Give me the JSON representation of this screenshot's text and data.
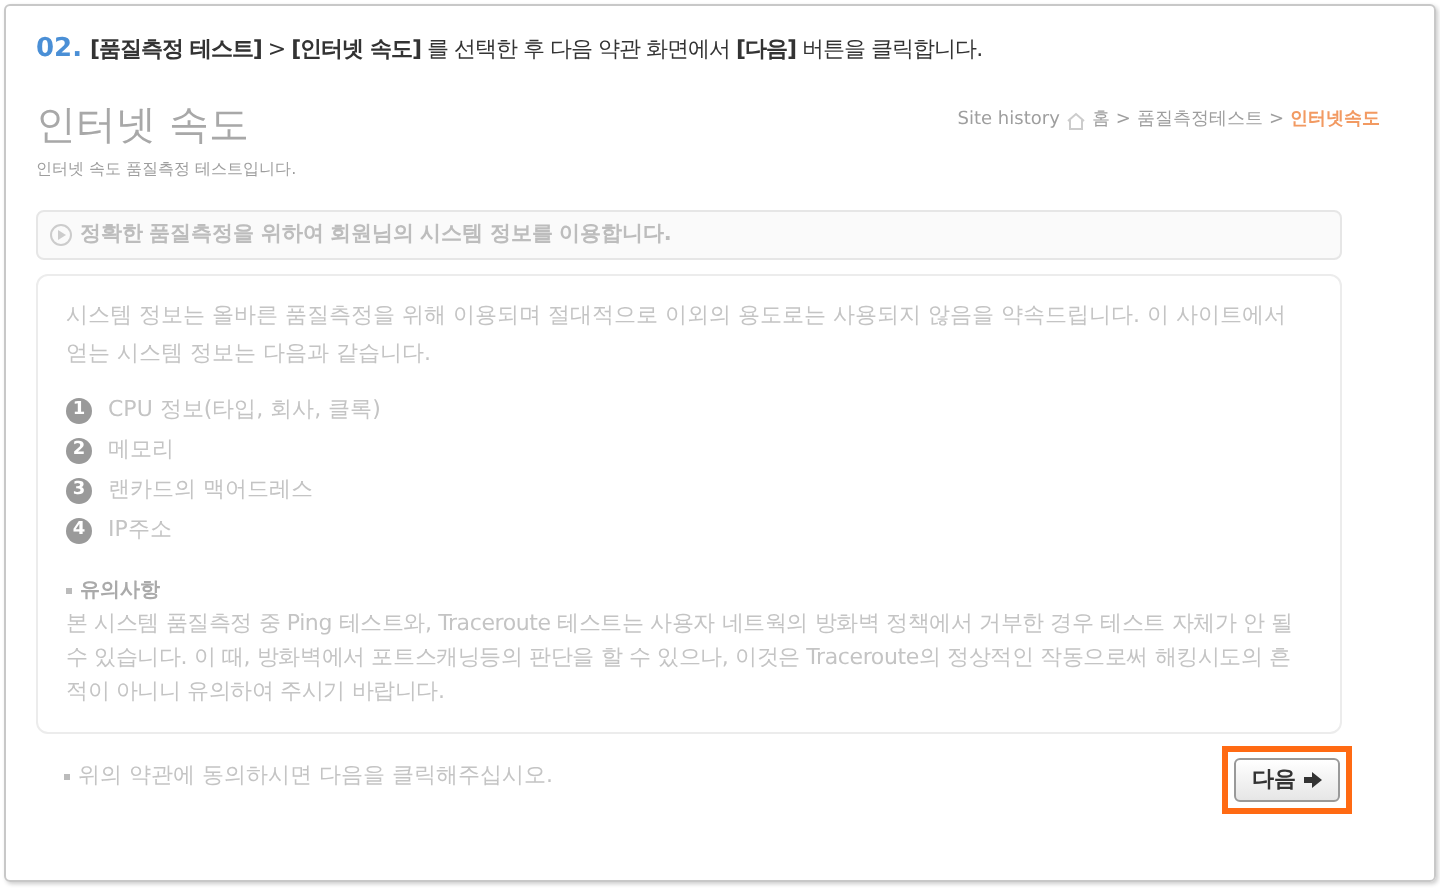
{
  "instruction": {
    "step": "02.",
    "text": "**[품질측정 테스트]** > **[인터넷 속도]** 를 선택한 후 다음 약관 화면에서 **[다음]** 버튼을 클릭합니다."
  },
  "page": {
    "title": "인터넷 속도",
    "subtitle": "인터넷 속도 품질측정 테스트입니다."
  },
  "breadcrumb": {
    "label": "Site history",
    "items": [
      {
        "text": "홈",
        "current": false
      },
      {
        "text": "품질측정테스트",
        "current": false
      },
      {
        "text": "인터넷속도",
        "current": true
      }
    ],
    "separator": ">"
  },
  "notice": "정확한 품질측정을 위하여 회원님의 시스템 정보를 이용합니다.",
  "terms": {
    "intro": "시스템 정보는 올바른 품질측정을 위해 이용되며 절대적으로 이외의 용도로는 사용되지 않음을 약속드립니다. 이 사이트에서 얻는 시스템 정보는 다음과 같습니다.",
    "items": [
      {
        "number": "1",
        "text": "CPU 정보(타입, 회사, 클록)"
      },
      {
        "number": "2",
        "text": "메모리"
      },
      {
        "number": "3",
        "text": "랜카드의 맥어드레스"
      },
      {
        "number": "4",
        "text": "IP주소"
      }
    ],
    "caution_title": "유의사항",
    "caution_text": "본 시스템 품질측정 중 Ping 테스트와, Traceroute 테스트는 사용자 네트웍의 방화벽 정책에서 거부한 경우 테스트 자체가 안 될 수 있습니다. 이 때, 방화벽에서 포트스캐닝등의 판단을 할 수 있으나, 이것은 Traceroute의 정상적인 작동으로써 해킹시도의 흔적이 아니니 유의하여 주시기 바랍니다."
  },
  "agree_text": "위의 약관에 동의하시면 다음을 클릭해주십시오.",
  "next_button": {
    "label": "다음",
    "highlighted": true
  }
}
